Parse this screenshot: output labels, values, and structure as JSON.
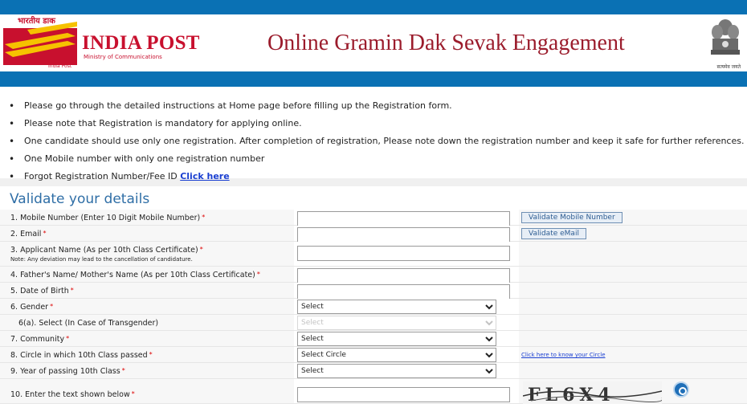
{
  "header": {
    "logo_hindi": "भारतीय डाक",
    "logo_title": "INDIA POST",
    "logo_ministry": "Ministry of Communications",
    "logo_small": "India Post",
    "site_title": "Online Gramin Dak Sevak Engagement",
    "emblem_text": "सत्यमेव जयते"
  },
  "instructions": {
    "items": [
      "Please go through the detailed instructions at Home page before filling up the Registration form.",
      "Please note that Registration is mandatory for applying online.",
      "One candidate should use only one registration. After completion of registration, Please note down the registration number and keep it safe for further references.",
      "One Mobile number with only one registration number"
    ],
    "forgot_text": "Forgot Registration Number/Fee ID ",
    "forgot_link": "Click here"
  },
  "form": {
    "title": "Validate your details",
    "required_mark": "*",
    "fields": {
      "mobile": "1. Mobile Number (Enter 10 Digit Mobile Number)",
      "email": "2. Email",
      "name": "3. Applicant Name (As per 10th Class Certificate)",
      "name_note": "Note: Any deviation may lead to the cancellation of candidature.",
      "parent": "4. Father's Name/ Mother's Name (As per 10th Class Certificate)",
      "dob": "5. Date of Birth",
      "gender": "6. Gender",
      "transgender": "6(a). Select (In Case of Transgender)",
      "community": "7. Community",
      "circle": "8. Circle in which 10th Class passed",
      "year": "9. Year of passing 10th Class",
      "captcha": "10. Enter the text shown below"
    },
    "select_default": "Select",
    "circle_default": "Select Circle",
    "validate_mobile_label": "Validate Mobile Number",
    "validate_email_label": "Validate eMail",
    "circle_link": "Click here to know your Circle",
    "captcha_text": "FL6X4"
  },
  "colors": {
    "brand_blue": "#0a71b4",
    "brand_red": "#c8102e",
    "title_maroon": "#9b1c2c",
    "heading_blue": "#2f6ea6"
  }
}
